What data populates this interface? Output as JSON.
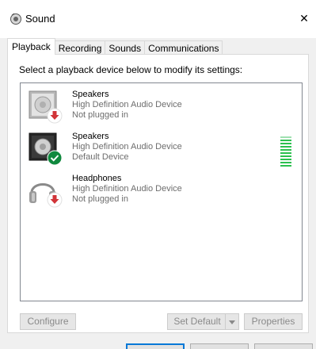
{
  "window": {
    "title": "Sound",
    "close_glyph": "✕"
  },
  "tabs": [
    {
      "label": "Playback",
      "active": true
    },
    {
      "label": "Recording",
      "active": false
    },
    {
      "label": "Sounds",
      "active": false
    },
    {
      "label": "Communications",
      "active": false
    }
  ],
  "panel": {
    "instruction": "Select a playback device below to modify its settings:"
  },
  "devices": [
    {
      "name": "Speakers",
      "description": "High Definition Audio Device",
      "status": "Not plugged in",
      "icon": "speaker-icon",
      "badge": "red-down-arrow-badge",
      "selected": false
    },
    {
      "name": "Speakers",
      "description": "High Definition Audio Device",
      "status": "Default Device",
      "icon": "speaker-icon",
      "badge": "green-check-badge",
      "selected": true,
      "level_meter_segments": 10
    },
    {
      "name": "Headphones",
      "description": "High Definition Audio Device",
      "status": "Not plugged in",
      "icon": "headphones-icon",
      "badge": "red-down-arrow-badge",
      "selected": false
    }
  ],
  "buttons": {
    "configure": "Configure",
    "set_default": "Set Default",
    "properties": "Properties"
  },
  "colors": {
    "accent": "#0078d7",
    "status_red": "#d13438",
    "status_green": "#10893e",
    "level_green": "#2cc04f",
    "disabled_text": "#8a8a8a"
  }
}
